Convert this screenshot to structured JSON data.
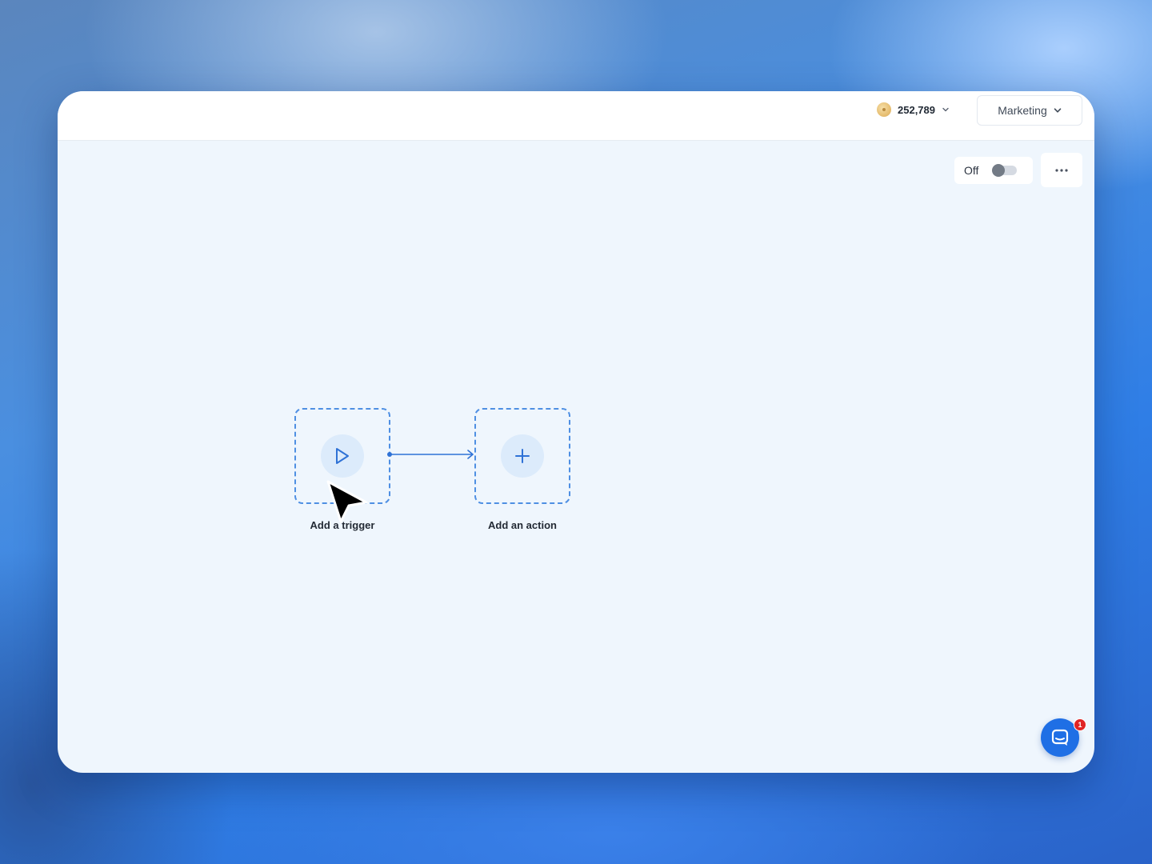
{
  "header": {
    "credits": {
      "value": "252,789",
      "icon": "coin-icon"
    },
    "team_selector": {
      "label": "Marketing",
      "icon": "chevron-down-icon"
    }
  },
  "toolbar": {
    "status_toggle": {
      "label": "Off",
      "state": "off"
    },
    "more_button": {
      "icon": "more-horizontal-icon"
    }
  },
  "workflow": {
    "trigger": {
      "label": "Add a trigger",
      "icon": "play-icon"
    },
    "action": {
      "label": "Add an action",
      "icon": "plus-icon"
    },
    "connector": {
      "icon": "arrow-right-icon"
    }
  },
  "chat": {
    "icon": "chat-icon",
    "badge_count": "1"
  },
  "colors": {
    "accent": "#1f6fe5",
    "node_border": "#4e8fe3",
    "canvas": "#eff6fd",
    "badge": "#e02424"
  }
}
